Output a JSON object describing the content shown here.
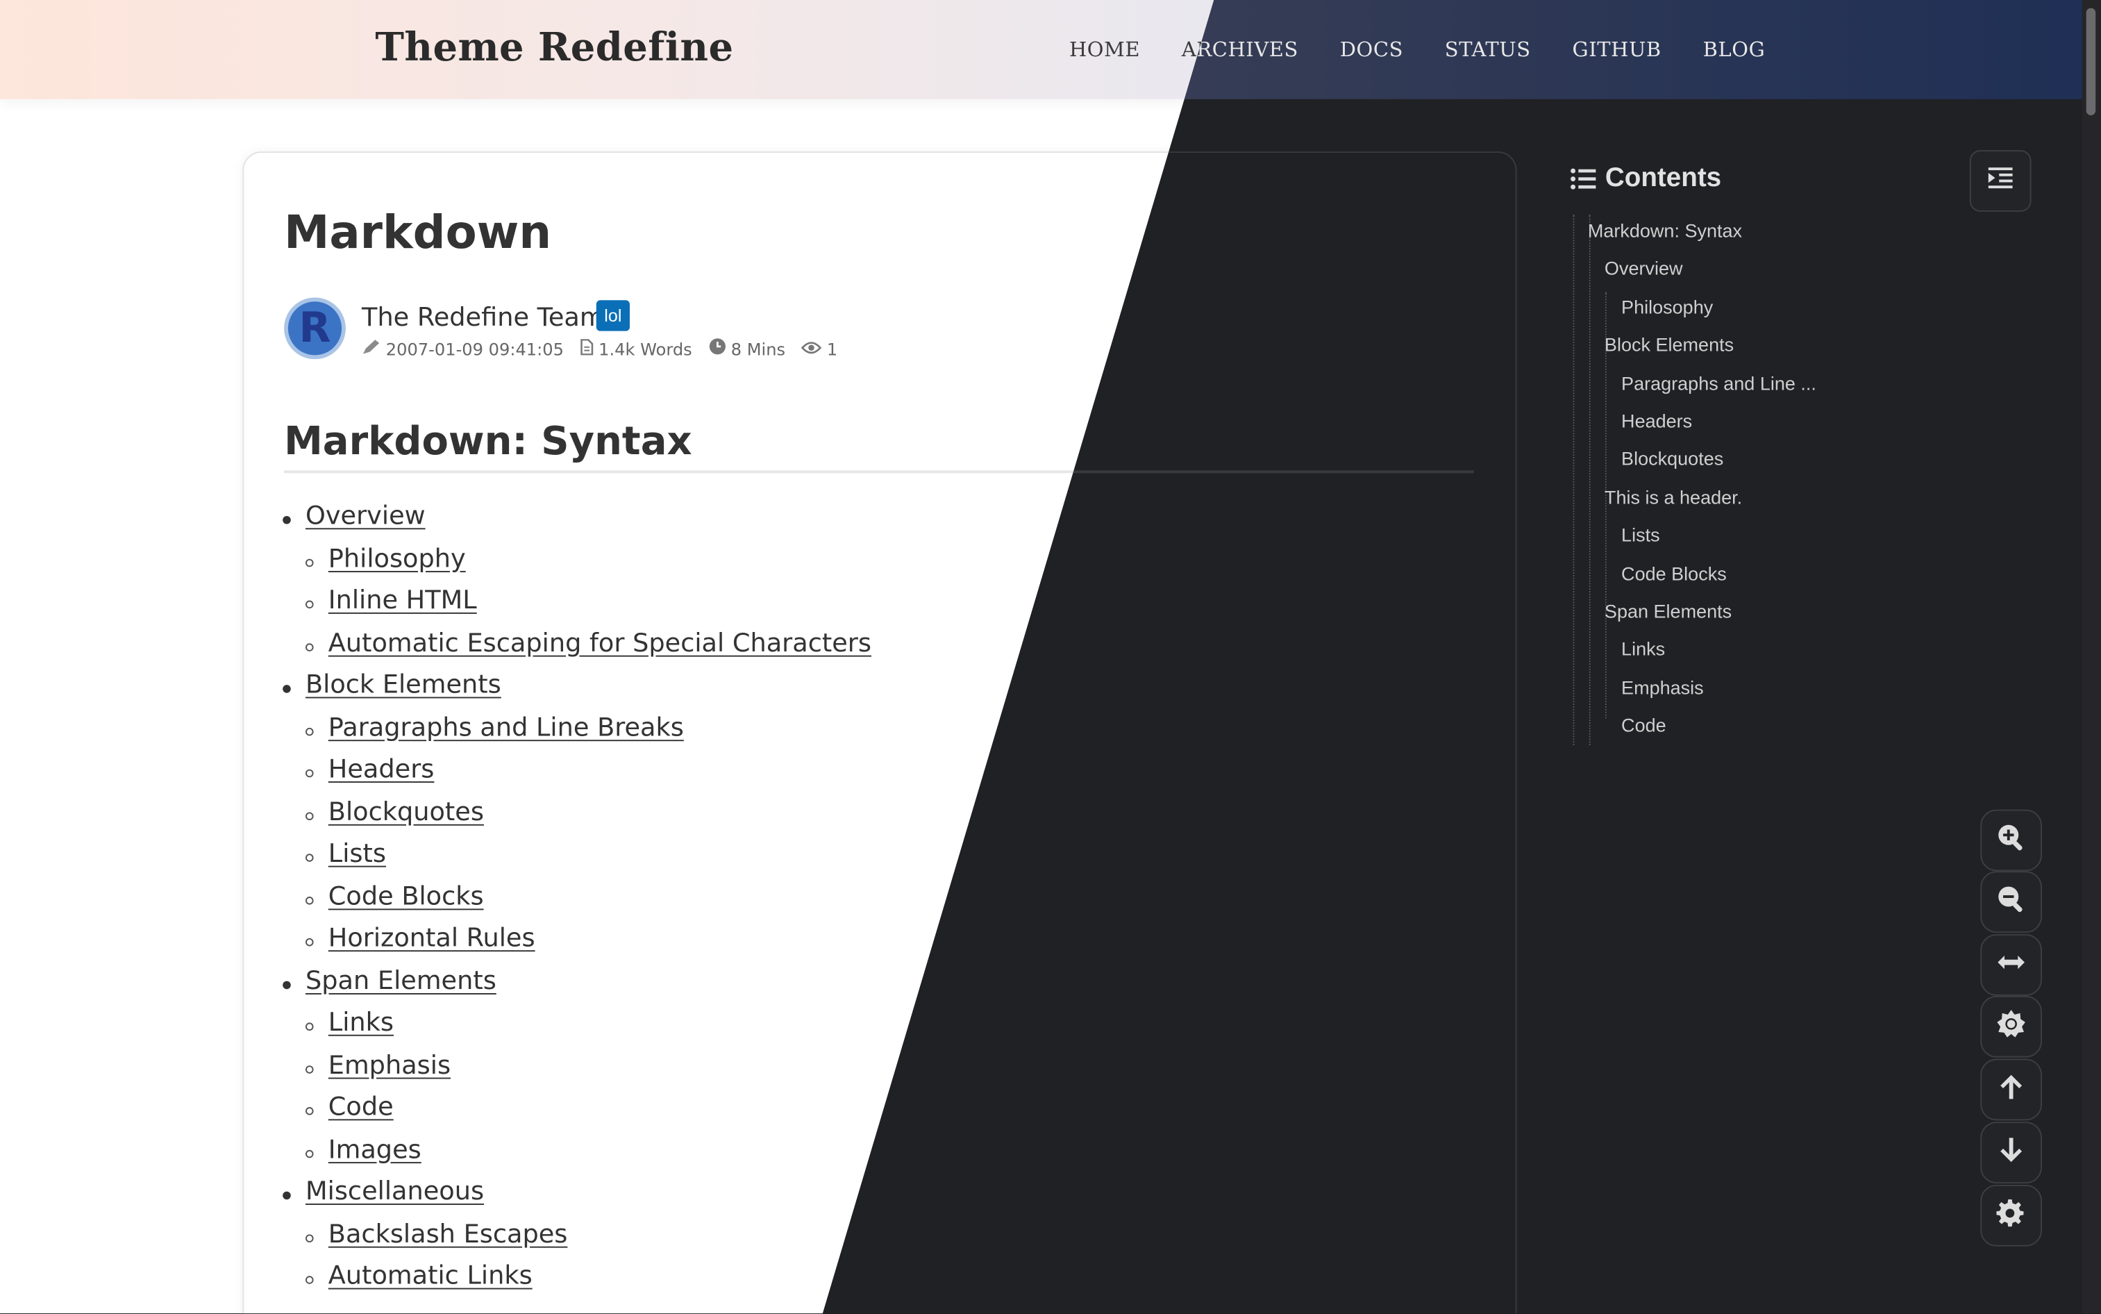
{
  "site": {
    "title": "Theme Redefine",
    "nav": [
      "HOME",
      "ARCHIVES",
      "DOCS",
      "STATUS",
      "GITHUB",
      "BLOG"
    ]
  },
  "post": {
    "title": "Markdown",
    "avatar_letter": "R",
    "author": "The Redefine Team",
    "badge": "lol",
    "date": "2007-01-09 09:41:05",
    "words": "1.4k Words",
    "read_time": "8 Mins",
    "views": "1",
    "heading": "Markdown: Syntax"
  },
  "content_list": [
    {
      "text": "Overview",
      "level": 1
    },
    {
      "text": "Philosophy",
      "level": 2
    },
    {
      "text": "Inline HTML",
      "level": 2
    },
    {
      "text": "Automatic Escaping for Special Characters",
      "level": 2
    },
    {
      "text": "Block Elements",
      "level": 1
    },
    {
      "text": "Paragraphs and Line Breaks",
      "level": 2
    },
    {
      "text": "Headers",
      "level": 2
    },
    {
      "text": "Blockquotes",
      "level": 2
    },
    {
      "text": "Lists",
      "level": 2
    },
    {
      "text": "Code Blocks",
      "level": 2
    },
    {
      "text": "Horizontal Rules",
      "level": 2
    },
    {
      "text": "Span Elements",
      "level": 1
    },
    {
      "text": "Links",
      "level": 2
    },
    {
      "text": "Emphasis",
      "level": 2
    },
    {
      "text": "Code",
      "level": 2
    },
    {
      "text": "Images",
      "level": 2
    },
    {
      "text": "Miscellaneous",
      "level": 1
    },
    {
      "text": "Backslash Escapes",
      "level": 2
    },
    {
      "text": "Automatic Links",
      "level": 2
    }
  ],
  "toc": {
    "title": "Contents",
    "items": [
      {
        "text": "Markdown: Syntax",
        "level": 1
      },
      {
        "text": "Overview",
        "level": 2
      },
      {
        "text": "Philosophy",
        "level": 3
      },
      {
        "text": "Block Elements",
        "level": 2
      },
      {
        "text": "Paragraphs and Line ...",
        "level": 3
      },
      {
        "text": "Headers",
        "level": 3
      },
      {
        "text": "Blockquotes",
        "level": 3
      },
      {
        "text": "This is a header.",
        "level": 2
      },
      {
        "text": "Lists",
        "level": 3
      },
      {
        "text": "Code Blocks",
        "level": 3
      },
      {
        "text": "Span Elements",
        "level": 2
      },
      {
        "text": "Links",
        "level": 3
      },
      {
        "text": "Emphasis",
        "level": 3
      },
      {
        "text": "Code",
        "level": 3
      }
    ]
  },
  "tools": [
    "zoom-in-icon",
    "zoom-out-icon",
    "expand-width-icon",
    "brightness-icon",
    "arrow-up-icon",
    "arrow-down-icon",
    "settings-gear-icon"
  ],
  "colors": {
    "badge": "#0b6fb7",
    "dark_bg": "#202124",
    "light_bg": "#ffffff"
  }
}
